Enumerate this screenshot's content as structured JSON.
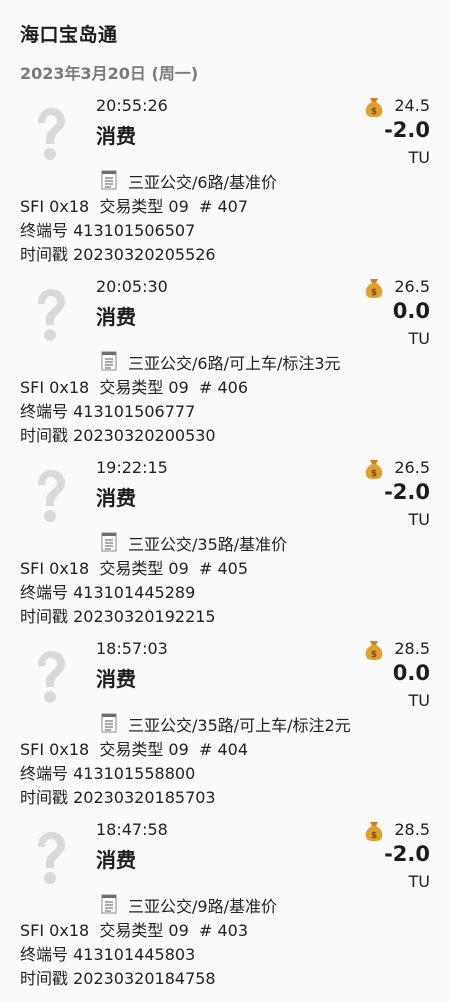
{
  "header": {
    "title": "海口宝岛通",
    "date": "2023年3月20日 (周一)"
  },
  "colors": {
    "balance_icon": "#e0a030",
    "unknown_icon": "#d9d9d9"
  },
  "icons": {
    "transaction": "question-mark-icon",
    "balance": "money-bag-icon",
    "route": "document-icon"
  },
  "transactions": [
    {
      "time": "20:55:26",
      "kind": "消费",
      "balance": "24.5",
      "amount": "-2.0",
      "unit": "TU",
      "route": "三亚公交/6路/基准价",
      "detail": "SFI 0x18  交易类型 09  # 407",
      "terminal": "终端号 413101506507",
      "timestamp": "时间戳 20230320205526"
    },
    {
      "time": "20:05:30",
      "kind": "消费",
      "balance": "26.5",
      "amount": "0.0",
      "unit": "TU",
      "route": "三亚公交/6路/可上车/标注3元",
      "detail": "SFI 0x18  交易类型 09  # 406",
      "terminal": "终端号 413101506777",
      "timestamp": "时间戳 20230320200530"
    },
    {
      "time": "19:22:15",
      "kind": "消费",
      "balance": "26.5",
      "amount": "-2.0",
      "unit": "TU",
      "route": "三亚公交/35路/基准价",
      "detail": "SFI 0x18  交易类型 09  # 405",
      "terminal": "终端号 413101445289",
      "timestamp": "时间戳 20230320192215"
    },
    {
      "time": "18:57:03",
      "kind": "消费",
      "balance": "28.5",
      "amount": "0.0",
      "unit": "TU",
      "route": "三亚公交/35路/可上车/标注2元",
      "detail": "SFI 0x18  交易类型 09  # 404",
      "terminal": "终端号 413101558800",
      "timestamp": "时间戳 20230320185703"
    },
    {
      "time": "18:47:58",
      "kind": "消费",
      "balance": "28.5",
      "amount": "-2.0",
      "unit": "TU",
      "route": "三亚公交/9路/基准价",
      "detail": "SFI 0x18  交易类型 09  # 403",
      "terminal": "终端号 413101445803",
      "timestamp": "时间戳 20230320184758"
    }
  ]
}
